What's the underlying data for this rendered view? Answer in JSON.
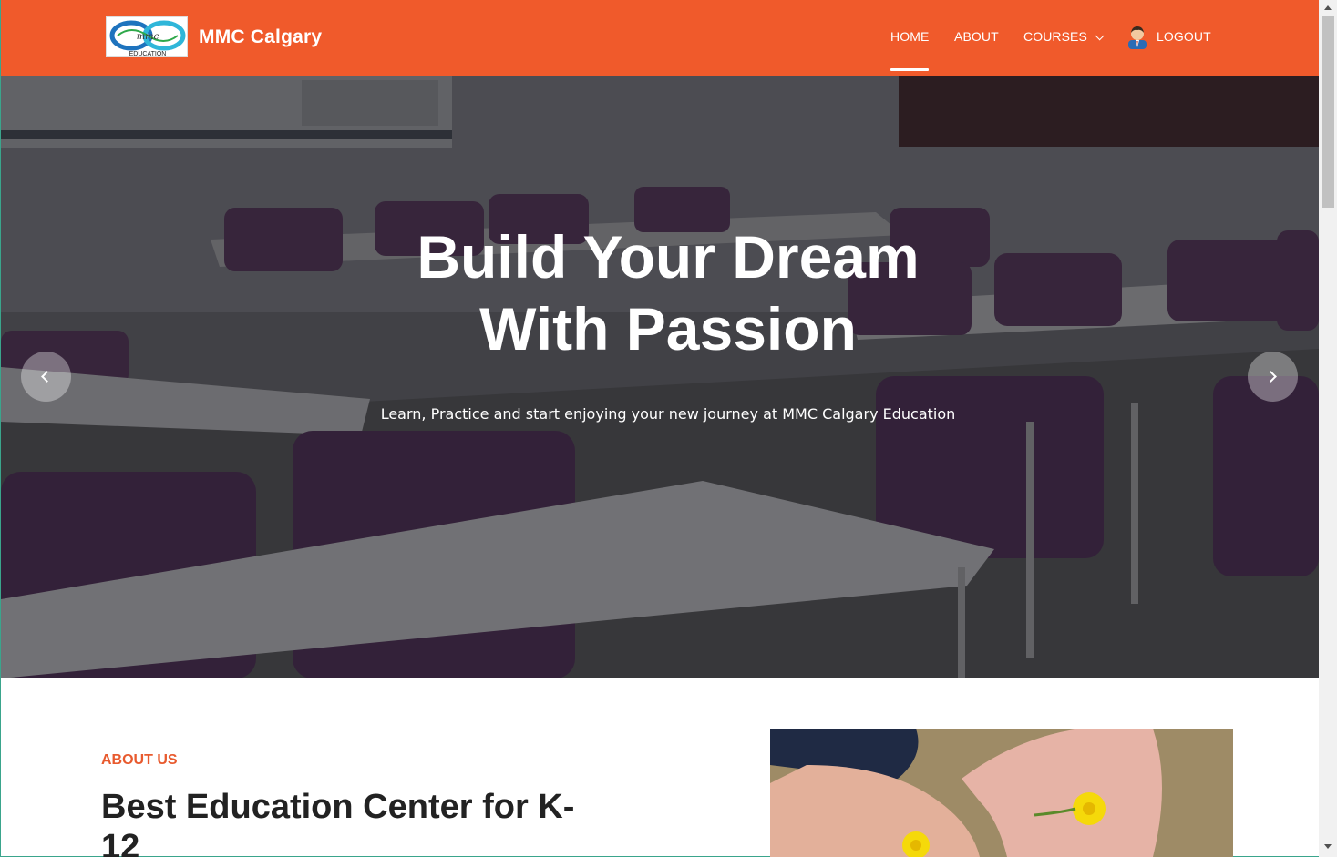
{
  "brand": {
    "name": "MMC Calgary",
    "logo_text": "EDUCATION"
  },
  "nav": {
    "home": "HOME",
    "about": "ABOUT",
    "courses": "COURSES",
    "logout": "LOGOUT"
  },
  "hero": {
    "title_line1": "Build Your Dream",
    "title_line2": "With Passion",
    "subtitle": "Learn, Practice and start enjoying your new journey at MMC Calgary Education"
  },
  "about": {
    "label": "ABOUT US",
    "title": "Best Education Center for K-12"
  },
  "colors": {
    "brand": "#f05a2b",
    "accent_text": "#e85a2e"
  },
  "icons": [
    "chevron-down-icon",
    "user-avatar-icon",
    "chevron-left-icon",
    "chevron-right-icon"
  ]
}
